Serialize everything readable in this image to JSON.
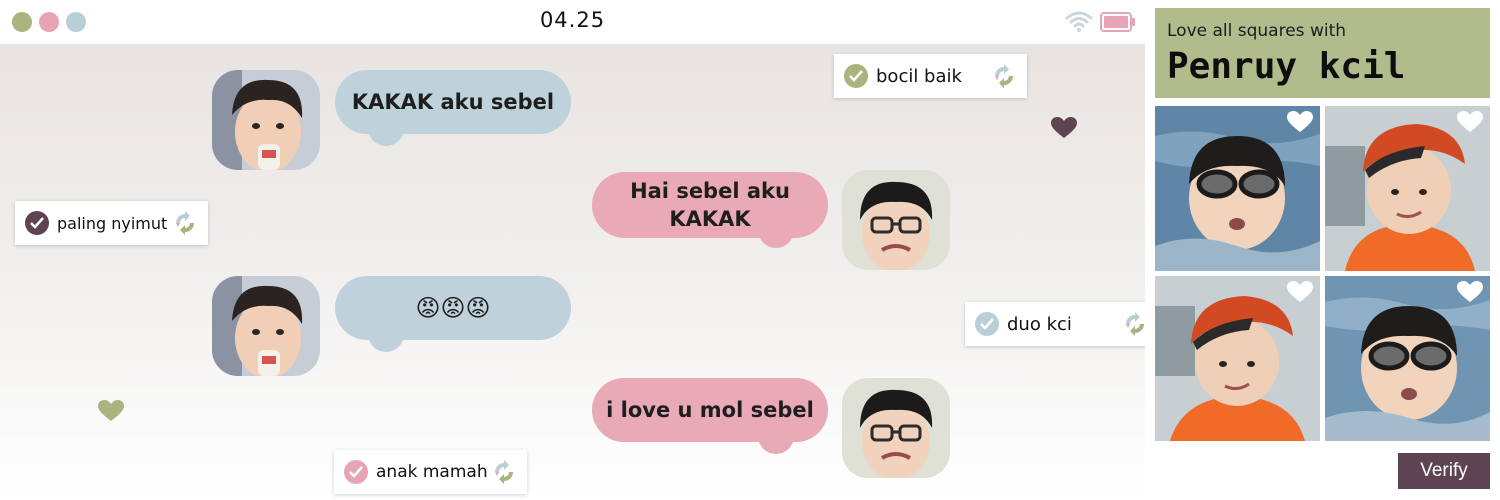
{
  "statusbar": {
    "time": "04.25",
    "window_dots": [
      "#a9b47e",
      "#e6a4b4",
      "#b9cfd7"
    ]
  },
  "messages": [
    {
      "side": "left",
      "text": "KAKAK aku sebel"
    },
    {
      "side": "right",
      "text": "Hai sebel aku KAKAK"
    },
    {
      "side": "left",
      "text": "😡😡😡"
    },
    {
      "side": "right",
      "text": "i love u mol sebel"
    }
  ],
  "tags": [
    {
      "label": "bocil baik",
      "check_color": "#a9b47e"
    },
    {
      "label": "paling nyimut",
      "check_color": "#5e4452"
    },
    {
      "label": "duo kci",
      "check_color": "#b9cfd7"
    },
    {
      "label": "anak mamah",
      "check_color": "#e6a4b4"
    }
  ],
  "captcha": {
    "instruction": "Love all squares with",
    "target": "Penruy kcil",
    "tiles": [
      {
        "subject": "boy-swimming-goggles"
      },
      {
        "subject": "boy-orange-cap"
      },
      {
        "subject": "boy-orange-cap"
      },
      {
        "subject": "boy-swimming-goggles"
      }
    ],
    "verify_label": "Verify"
  },
  "colors": {
    "accent_olive": "#a9b47e",
    "accent_pink": "#e6a4b4",
    "accent_blue": "#b9cfd7",
    "accent_plum": "#5e4452"
  }
}
